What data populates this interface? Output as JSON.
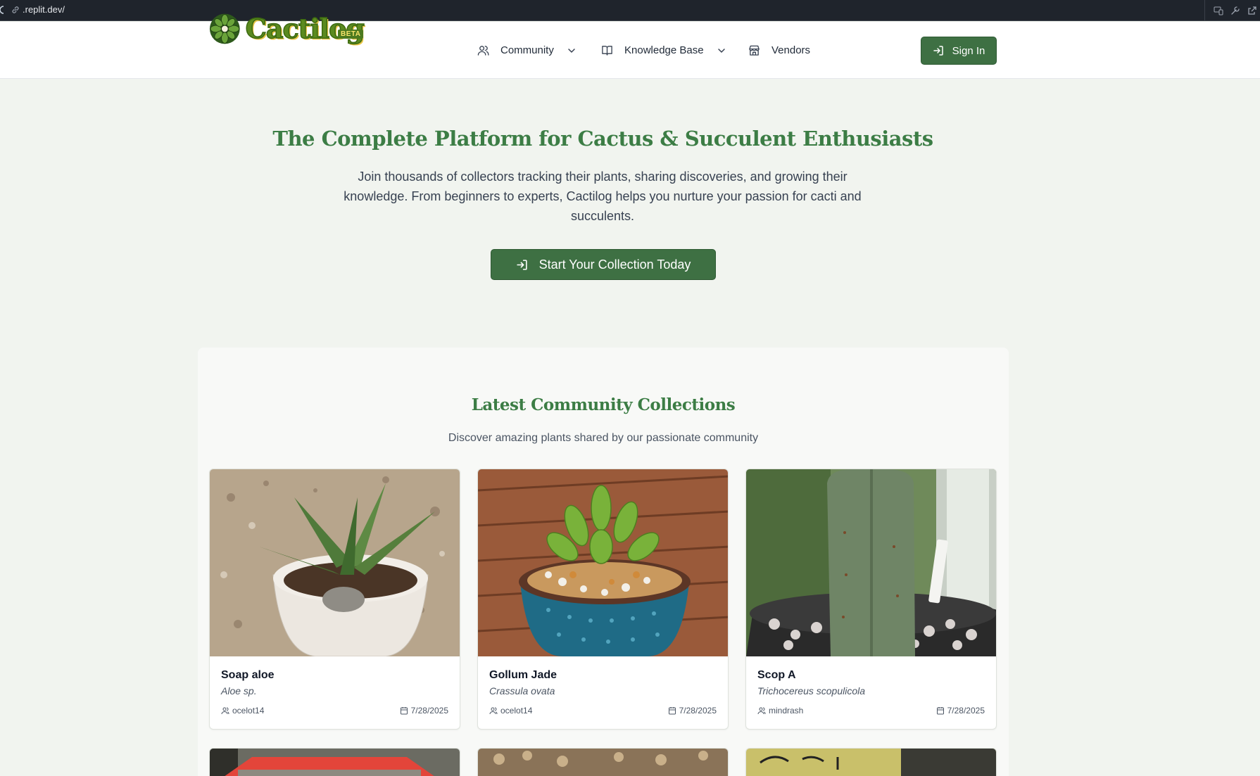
{
  "browser": {
    "url": ".replit.dev/"
  },
  "header": {
    "logo_text": "Cactilog",
    "beta_badge": "BETA",
    "nav": [
      {
        "label": "Community",
        "icon": "users-icon",
        "has_dropdown": true
      },
      {
        "label": "Knowledge Base",
        "icon": "book-icon",
        "has_dropdown": true
      },
      {
        "label": "Vendors",
        "icon": "store-icon",
        "has_dropdown": false
      }
    ],
    "sign_in_label": "Sign In"
  },
  "hero": {
    "title": "The Complete Platform for Cactus & Succulent Enthusiasts",
    "description": "Join thousands of collectors tracking their plants, sharing discoveries, and growing their knowledge. From beginners to experts, Cactilog helps you nurture your passion for cacti and succulents.",
    "cta_label": "Start Your Collection Today"
  },
  "collections": {
    "title": "Latest Community Collections",
    "subtitle": "Discover amazing plants shared by our passionate community",
    "cards": [
      {
        "name": "Soap aloe",
        "species": "Aloe sp.",
        "user": "ocelot14",
        "date": "7/28/2025"
      },
      {
        "name": "Gollum Jade",
        "species": "Crassula ovata",
        "user": "ocelot14",
        "date": "7/28/2025"
      },
      {
        "name": "Scop A",
        "species": "Trichocereus scopulicola",
        "user": "mindrash",
        "date": "7/28/2025"
      }
    ]
  },
  "colors": {
    "brand_green": "#3e7043",
    "title_green": "#3c7d45",
    "page_bg": "#f1f4ef"
  }
}
